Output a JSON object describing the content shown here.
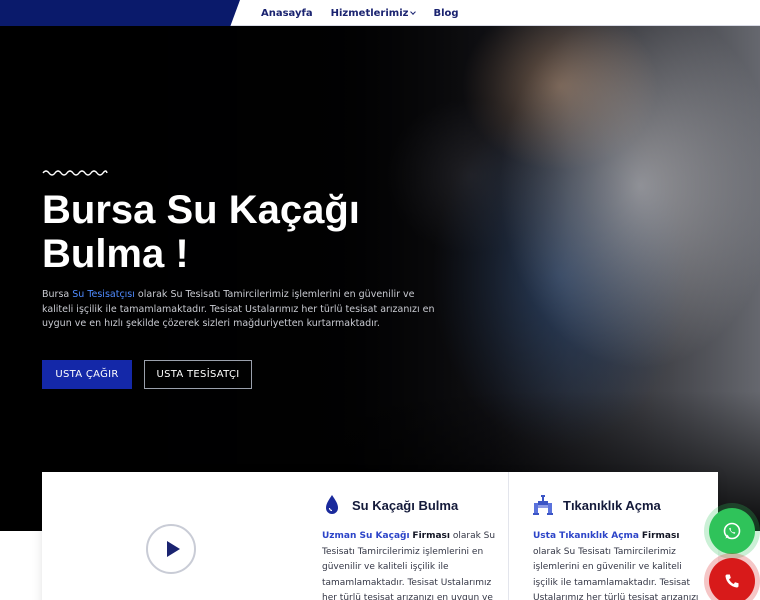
{
  "header": {
    "nav": [
      {
        "label": "Anasayfa"
      },
      {
        "label": "Hizmetlerimiz",
        "has_dropdown": true
      },
      {
        "label": "Blog"
      }
    ]
  },
  "hero": {
    "title_line1": "Bursa Su Kaçağı",
    "title_line2": "Bulma !",
    "text_prefix": "Bursa",
    "text_link": "Su Tesisatçısı",
    "text_body": "olarak Su Tesisatı Tamircilerimiz işlemlerini en güvenilir ve kaliteli işçilik ile tamamlamaktadır.  Tesisat Ustalarımız her türlü tesisat arızanızı en uygun ve en hızlı şekilde çözerek sizleri mağduriyetten kurtarmaktadır.",
    "primary_button": "USTA ÇAĞIR",
    "secondary_button": "USTA TESİSATÇI"
  },
  "cards": [
    {
      "title": "Su Kaçağı Bulma",
      "icon": "water-drop-icon",
      "link_text": "Uzman Su Kaçağı",
      "bold_text": "Firması",
      "body": "olarak Su Tesisatı Tamircilerimiz işlemlerini en güvenilir ve kaliteli işçilik ile tamamlamaktadır.  Tesisat Ustalarımız her türlü tesisat arızanızı en uygun ve"
    },
    {
      "title": "Tıkanıklık Açma",
      "icon": "pipe-valve-icon",
      "link_text": "Usta Tıkanıklık Açma",
      "bold_text": "Firması",
      "body": "olarak Su Tesisatı Tamircilerimiz işlemlerini en güvenilir ve kaliteli işçilik ile tamamlamaktadır.  Tesisat Ustalarımız her türlü tesisat arızanızı en uygun ve"
    }
  ],
  "colors": {
    "brand_navy": "#0a1a6b",
    "primary_blue": "#1428a8",
    "link_blue": "#2c44c8",
    "whatsapp_green": "#2fc35a",
    "call_red": "#d81a1a"
  },
  "floating": {
    "whatsapp_icon": "whatsapp-icon",
    "call_icon": "phone-icon"
  }
}
